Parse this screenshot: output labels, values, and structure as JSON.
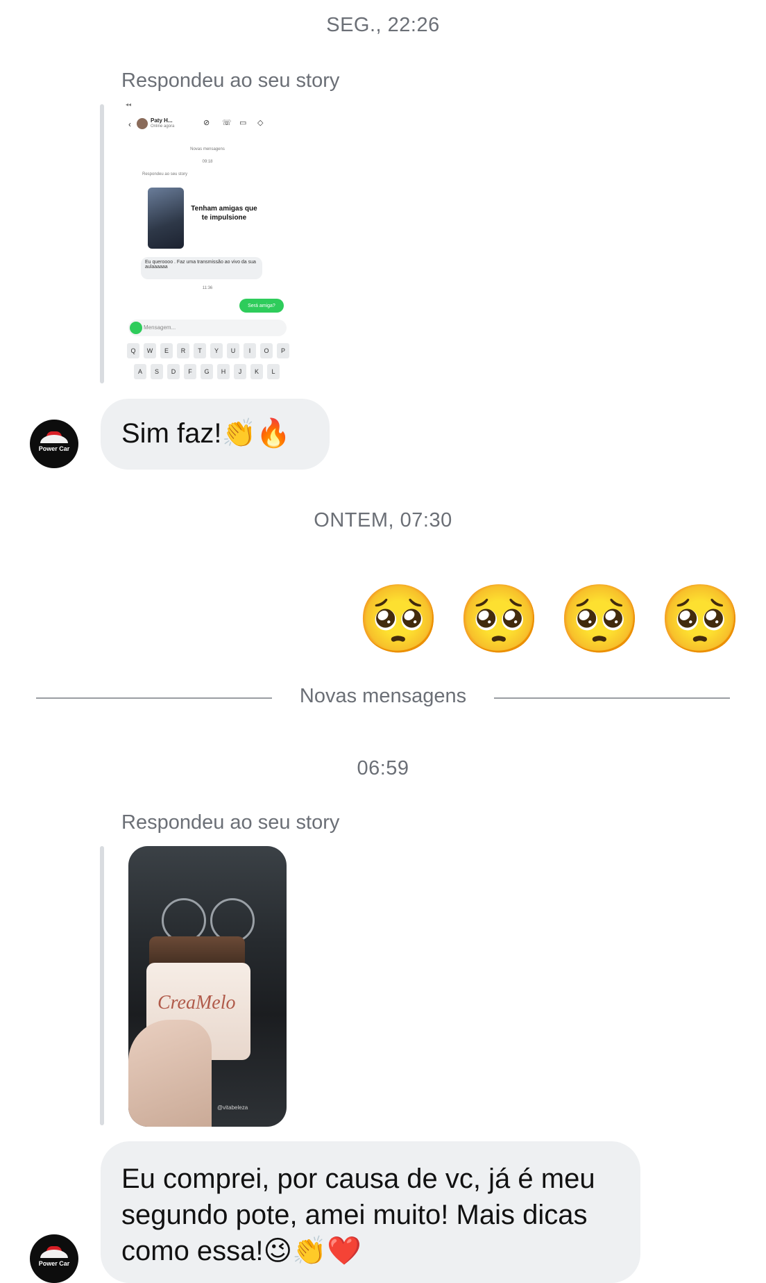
{
  "thread": {
    "timestamp_1": "SEG., 22:26",
    "reply_label_1": "Respondeu ao seu story",
    "story_1": {
      "contact_name": "Paty H...",
      "contact_status": "Online agora",
      "new_messages_label": "Novas mensagens",
      "time_a": "09:18",
      "reply_label": "Respondeu ao seu story",
      "story_text": "Tenham amigas que te impulsione",
      "incoming_message": "Eu queroooo . Faz uma transmissão ao vivo da sua aulaaaaaa",
      "time_b": "11:36",
      "outgoing_message": "Será amiga?",
      "input_placeholder": "Mensagem...",
      "keyboard_row_1": [
        "Q",
        "W",
        "E",
        "R",
        "T",
        "Y",
        "U",
        "I",
        "O",
        "P"
      ],
      "keyboard_row_2": [
        "A",
        "S",
        "D",
        "F",
        "G",
        "H",
        "J",
        "K",
        "L"
      ]
    },
    "message_1": "Sim faz!",
    "message_1_emojis": "👏🔥",
    "timestamp_2": "ONTEM, 07:30",
    "sent_emojis": [
      "🥺",
      "🥺",
      "🥺",
      "🥺"
    ],
    "new_messages_divider": "Novas mensagens",
    "timestamp_3": "06:59",
    "reply_label_2": "Respondeu ao seu story",
    "story_2": {
      "product_name": "CreaMelo",
      "credit": "@vitabeleza"
    },
    "message_2_line_1": "Eu comprei, por causa de vc, já é meu",
    "message_2_line_2": "segundo pote, amei muito! Mais dicas",
    "message_2_line_3": "como essa!",
    "message_2_emojis": "😉👏❤️",
    "avatar_text": "Power Car",
    "colors": {
      "background": "#ffffff",
      "bubble_in": "#eef0f2",
      "meta_text": "#6b6f76",
      "accent_green": "#2ecc5b"
    },
    "icons": [
      "reply-bar",
      "avatar-logo",
      "emoji"
    ]
  }
}
